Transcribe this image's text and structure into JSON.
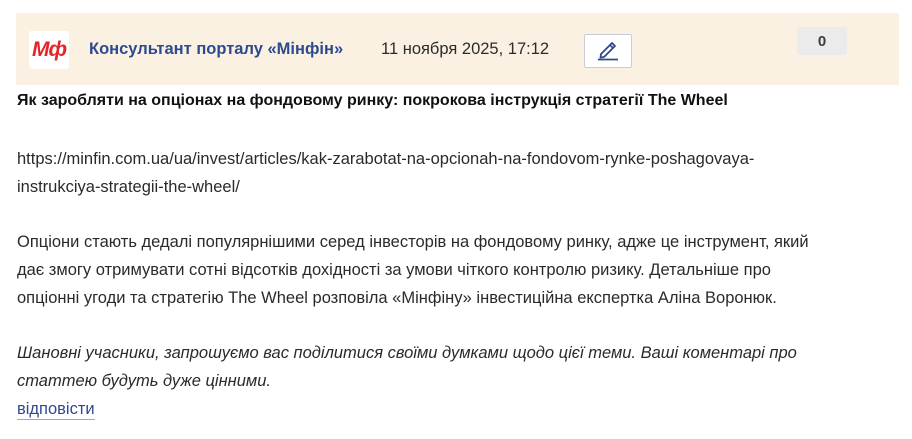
{
  "post": {
    "avatar_text": "Мф",
    "author": "Консультант порталу «Мінфін»",
    "date": "11 ноября 2025, 17:12",
    "edit_icon": "pencil-icon",
    "counter": "0",
    "title": "Як заробляти на опціонах на фондовому ринку: покрокова інструкція стратегії The Wheel",
    "link_line1": "https://minfin.com.ua/ua/invest/articles/kak-zarabotat-na-opcionah-na-fondovom-rynke-poshagovaya-",
    "link_line2": "instrukciya-strategii-the-wheel/",
    "para_line1": "Опціони стають дедалі популярнішими серед інвесторів на фондовому ринку, адже це інструмент, який",
    "para_line2": "дає змогу отримувати сотні відсотків дохідності за умови чіткого контролю ризику. Детальніше про",
    "para_line3": "опціонні угоди та стратегію The Wheel розповіла «Мінфіну» інвестиційна експертка Аліна Воронюк.",
    "italic_line1": "Шановні учасники, запрошуємо вас поділитися своїми думками щодо цієї теми. Ваші коментарі про",
    "italic_line2": "статтею будуть дуже цінними.",
    "reply_label": "відповісти"
  },
  "colors": {
    "header_bg": "#fbf1e3",
    "accent_link": "#2d4a8f",
    "logo_red": "#e3262a"
  }
}
